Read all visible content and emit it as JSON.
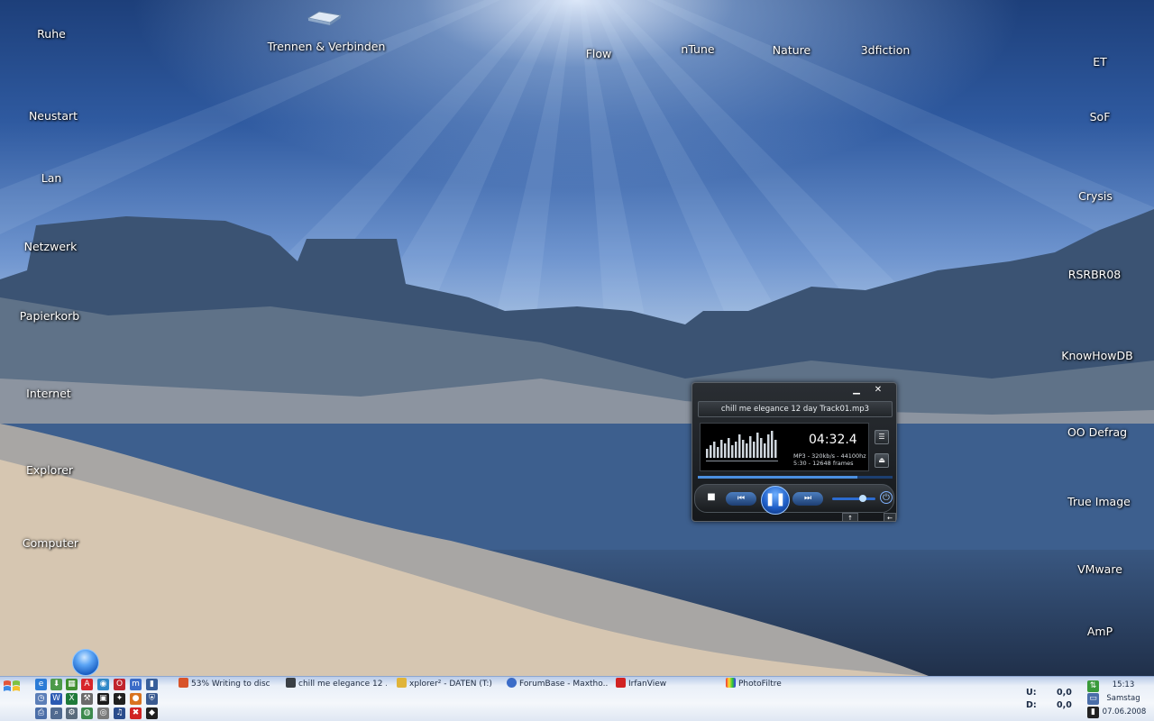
{
  "desktop": {
    "left_icons": [
      "Ruhe",
      "Neustart",
      "Lan",
      "Netzwerk",
      "Papierkorb",
      "Internet",
      "Explorer",
      "Computer"
    ],
    "top_icons": [
      "Trennen & Verbinden",
      "Flow",
      "nTune",
      "Nature",
      "3dfiction"
    ],
    "right_icons": [
      "ET",
      "SoF",
      "Crysis",
      "RSRBR08",
      "KnowHowDB",
      "OO Defrag",
      "True Image",
      "VMware",
      "AmP"
    ]
  },
  "player": {
    "title": "chill me elegance 12 day Track01.mp3",
    "time": "04:32.4",
    "info_line1": "MP3 - 320kb/s - 44100hz",
    "info_line2": "5:30 - 12648 frames",
    "progress_fraction": 0.82,
    "volume_fraction": 0.7
  },
  "taskbar": {
    "tasks": [
      {
        "label": "53% Writing to disc",
        "icon": "burn-icon"
      },
      {
        "label": "chill me elegance 12 ...",
        "icon": "player-icon"
      },
      {
        "label": "xplorer² - DATEN (T:)",
        "icon": "folder-icon"
      },
      {
        "label": "ForumBase - Maxtho...",
        "icon": "browser-icon"
      },
      {
        "label": "IrfanView",
        "icon": "irfanview-icon"
      },
      {
        "label": "PhotoFiltre",
        "icon": "photofiltre-icon"
      }
    ],
    "tray": {
      "u_label": "U:",
      "u_value": "0,0",
      "d_label": "D:",
      "d_value": "0,0",
      "time": "15:13",
      "day": "Samstag",
      "date": "07.06.2008"
    }
  }
}
